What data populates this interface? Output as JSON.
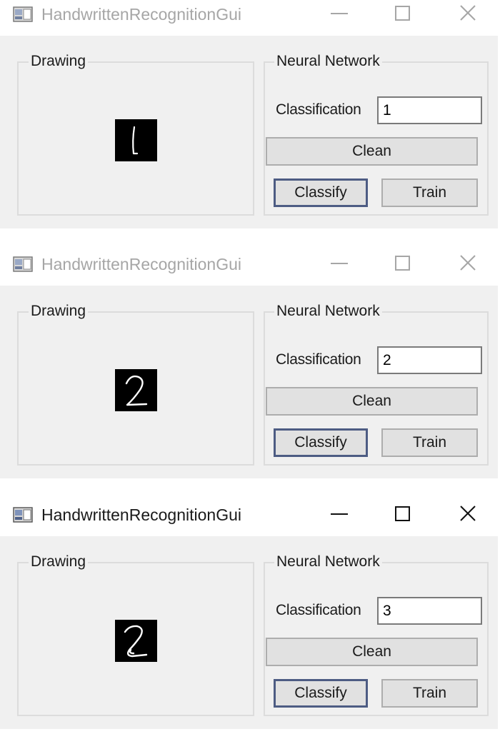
{
  "windows": [
    {
      "title": "HandwrittenRecognitionGui",
      "state": "inactive",
      "digit_drawn": "1",
      "drawing_group_label": "Drawing",
      "nn_group_label": "Neural Network",
      "classification_label": "Classification",
      "classification_value": "1",
      "clean_label": "Clean",
      "classify_label": "Classify",
      "train_label": "Train"
    },
    {
      "title": "HandwrittenRecognitionGui",
      "state": "inactive",
      "digit_drawn": "2",
      "drawing_group_label": "Drawing",
      "nn_group_label": "Neural Network",
      "classification_label": "Classification",
      "classification_value": "2",
      "clean_label": "Clean",
      "classify_label": "Classify",
      "train_label": "Train"
    },
    {
      "title": "HandwrittenRecognitionGui",
      "state": "active",
      "digit_drawn": "2",
      "drawing_group_label": "Drawing",
      "nn_group_label": "Neural Network",
      "classification_label": "Classification",
      "classification_value": "3",
      "clean_label": "Clean",
      "classify_label": "Classify",
      "train_label": "Train"
    }
  ],
  "icons": {
    "app": "app-window-icon",
    "minimize": "minimize-icon",
    "maximize": "maximize-icon",
    "close": "close-icon"
  },
  "colors": {
    "client_background": "#f0f0f0",
    "button_face": "#e1e1e1",
    "default_button_border": "#4d5c83",
    "inactive_title_text": "#a6a6a6",
    "canvas_background": "#000000",
    "stroke": "#ffffff"
  }
}
